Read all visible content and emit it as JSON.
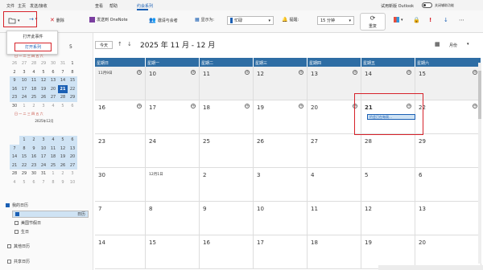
{
  "menubar": {
    "file": "文件",
    "home": "主页",
    "send_receive": "发送/接收",
    "view": "查看",
    "help": "帮助",
    "appointment_series": "约会系列",
    "try_new_outlook": "试用新版 Outlook",
    "toggle_label": "关闭辅助功能"
  },
  "ribbon": {
    "delete": "删除",
    "send_onenote": "发送到 OneNote",
    "invite": "邀请与会者",
    "show_as_label": "显示为:",
    "show_as_value": "忙碌",
    "reminder_label": "提醒:",
    "reminder_value": "15 分钟",
    "recurrence": "重复"
  },
  "open_menu": {
    "open_occurrence": "打开此事件",
    "open_series": "打开系列"
  },
  "mini": {
    "weekday_header": "日 一 二 三 四 五 六",
    "nov_title": "5",
    "nov_rows": [
      [
        "26",
        "27",
        "28",
        "29",
        "30",
        "31",
        "1"
      ],
      [
        "2",
        "3",
        "4",
        "5",
        "6",
        "7",
        "8"
      ],
      [
        "9",
        "10",
        "11",
        "12",
        "13",
        "14",
        "15"
      ],
      [
        "16",
        "17",
        "18",
        "19",
        "20",
        "21",
        "22"
      ],
      [
        "23",
        "24",
        "25",
        "26",
        "27",
        "28",
        "29"
      ],
      [
        "30",
        "1",
        "2",
        "3",
        "4",
        "5",
        "6"
      ]
    ],
    "dec_title": "2025年12月",
    "dec_rows": [
      [
        "",
        "1",
        "2",
        "3",
        "4",
        "5",
        "6"
      ],
      [
        "7",
        "8",
        "9",
        "10",
        "11",
        "12",
        "13"
      ],
      [
        "14",
        "15",
        "16",
        "17",
        "18",
        "19",
        "20"
      ],
      [
        "21",
        "22",
        "23",
        "24",
        "25",
        "26",
        "27"
      ],
      [
        "28",
        "29",
        "30",
        "31",
        "1",
        "2",
        "3"
      ],
      [
        "4",
        "5",
        "6",
        "7",
        "8",
        "9",
        "10"
      ]
    ]
  },
  "calendars": {
    "header": "我的日历",
    "items": [
      "日历",
      "美国节假日",
      "生日"
    ],
    "others": "其他日历",
    "shared": "共享日历"
  },
  "nav": {
    "today": "今天",
    "title": "2025 年 11 月 - 12 月",
    "view": "月份"
  },
  "weekdays": [
    "星期日",
    "星期一",
    "星期二",
    "星期三",
    "星期四",
    "星期五",
    "星期六"
  ],
  "weeks": [
    [
      "11月9日",
      "10",
      "11",
      "12",
      "13",
      "14",
      "15"
    ],
    [
      "16",
      "17",
      "18",
      "19",
      "20",
      "21",
      "22"
    ],
    [
      "23",
      "24",
      "25",
      "26",
      "27",
      "28",
      "29"
    ],
    [
      "30",
      "12月1日",
      "2",
      "3",
      "4",
      "5",
      "6"
    ],
    [
      "7",
      "8",
      "9",
      "10",
      "11",
      "12",
      "13"
    ],
    [
      "14",
      "15",
      "16",
      "17",
      "18",
      "19",
      "20"
    ]
  ],
  "event": "约会已在每周…",
  "colors": {
    "accent": "#1a5fb4",
    "header": "#2e6da4",
    "highlight": "#d6222a"
  }
}
